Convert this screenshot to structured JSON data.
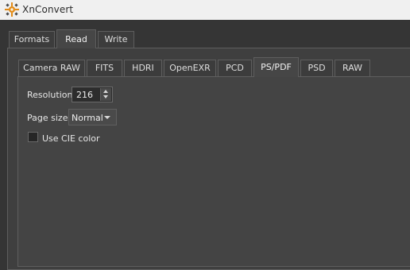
{
  "window": {
    "title": "XnConvert",
    "icon": "xnconvert-app-icon"
  },
  "outer_tabs": [
    {
      "label": "Formats",
      "active": false
    },
    {
      "label": "Read",
      "active": true
    },
    {
      "label": "Write",
      "active": false
    }
  ],
  "inner_tabs": [
    {
      "label": "Camera RAW",
      "active": false
    },
    {
      "label": "FITS",
      "active": false
    },
    {
      "label": "HDRI",
      "active": false
    },
    {
      "label": "OpenEXR",
      "active": false
    },
    {
      "label": "PCD",
      "active": false
    },
    {
      "label": "PS/PDF",
      "active": true
    },
    {
      "label": "PSD",
      "active": false
    },
    {
      "label": "RAW",
      "active": false
    }
  ],
  "settings": {
    "resolution_label": "Resolution",
    "resolution_value": "216",
    "page_size_label": "Page size",
    "page_size_value": "Normal",
    "use_cie_label": "Use CIE color",
    "use_cie_checked": false
  },
  "colors": {
    "titlebar": "#f0f0f0",
    "background": "#353535",
    "panel": "#444444",
    "tab_border": "#5e5e5e"
  }
}
